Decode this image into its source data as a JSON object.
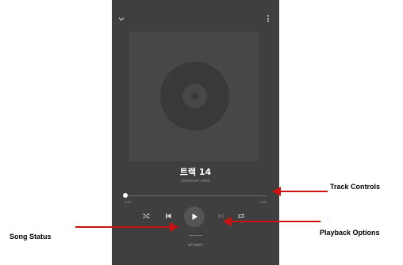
{
  "player": {
    "track_title": "트랙 14",
    "artist": "Unknown artist",
    "time_elapsed": "0:00",
    "time_total": "1:00",
    "progress_fraction": 0.0,
    "up_next_label": "UP NEXT"
  },
  "icons": {
    "collapse": "chevron-down-icon",
    "menu": "more-vert-icon",
    "shuffle": "shuffle-icon",
    "previous": "skip-previous-icon",
    "play": "play-icon",
    "next": "skip-next-icon",
    "repeat": "repeat-icon"
  },
  "annotations": {
    "track_controls": "Track Controls",
    "playback_options": "Playback Options",
    "song_status": "Song Status"
  },
  "colors": {
    "background": "#3f3f3f",
    "arrow": "#cc1111"
  }
}
